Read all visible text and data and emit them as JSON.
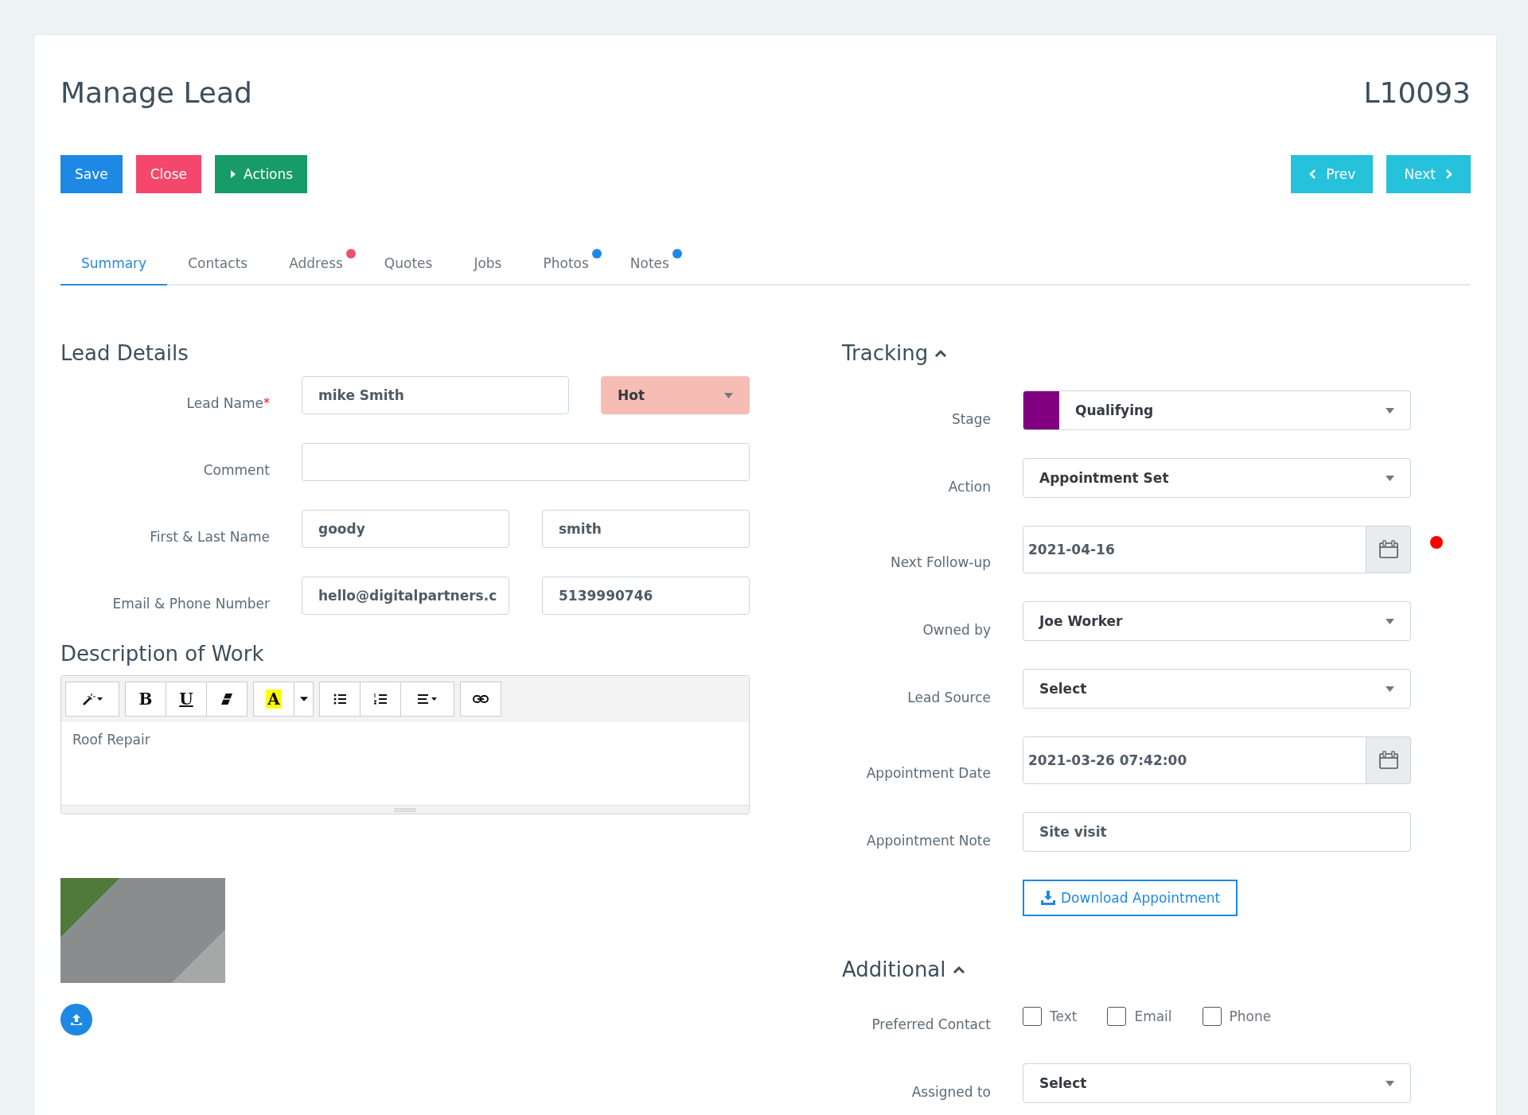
{
  "header": {
    "title": "Manage Lead",
    "record_id": "L10093"
  },
  "actions": [
    {
      "label": "Save",
      "kind": "save"
    },
    {
      "label": "Close",
      "kind": "close"
    },
    {
      "label": "Actions",
      "kind": "actions"
    }
  ],
  "pager": [
    {
      "label": "Prev",
      "kind": "prev"
    },
    {
      "label": "Next",
      "kind": "next"
    }
  ],
  "tabs": [
    {
      "label": "Summary",
      "selected": true
    },
    {
      "label": "Contacts",
      "selected": false
    },
    {
      "label": "Address",
      "selected": false,
      "color": "#f0506e"
    },
    {
      "label": "Quotes",
      "selected": false
    },
    {
      "label": "Jobs",
      "selected": false
    },
    {
      "label": "Photos",
      "selected": false,
      "color": "#1e88e5"
    },
    {
      "label": "Notes",
      "selected": false,
      "color": "#1e88e5"
    }
  ],
  "lead_details": {
    "heading": "Lead Details",
    "rows": [
      {
        "kind": "name_priority",
        "label": "Lead Name",
        "required_mark": "*",
        "value": "mike Smith",
        "priority": {
          "value": "Hot",
          "color": "#f6bdb5"
        }
      },
      {
        "kind": "text",
        "label": "Comment"
      },
      {
        "kind": "pair",
        "label": "First & Last Name",
        "values": [
          "goody",
          "smith"
        ]
      },
      {
        "kind": "pair",
        "label": "Email & Phone Number",
        "values": [
          "hello@digitalpartners.c",
          "5139990746"
        ]
      }
    ]
  },
  "description": {
    "heading": "Description of Work",
    "content": "Roof Repair",
    "toolbar": [
      {
        "kind": "style"
      },
      {
        "kind": "bold",
        "label": "B"
      },
      {
        "kind": "underline",
        "label": "U"
      },
      {
        "kind": "eraser"
      },
      {
        "kind": "highlight",
        "label": "A"
      },
      {
        "kind": "dropdown"
      },
      {
        "kind": "bullets"
      },
      {
        "kind": "numbers"
      },
      {
        "kind": "align"
      },
      {
        "kind": "link"
      }
    ]
  },
  "tracking": {
    "heading": "Tracking",
    "expanded": true,
    "rows": [
      {
        "kind": "stage",
        "label": "Stage",
        "value": "Qualifying",
        "color": "#800080"
      },
      {
        "kind": "select",
        "label": "Action",
        "value": "Appointment Set"
      },
      {
        "kind": "date",
        "label": "Next Follow-up",
        "value": "2021-04-16",
        "alert": true
      },
      {
        "kind": "select",
        "label": "Owned by",
        "value": "Joe Worker"
      },
      {
        "kind": "select",
        "label": "Lead Source",
        "value": "Select"
      },
      {
        "kind": "date",
        "label": "Appointment Date",
        "value": "2021-03-26 07:42:00"
      },
      {
        "kind": "text",
        "label": "Appointment Note",
        "value": "Site visit"
      },
      {
        "kind": "button",
        "label": "Download Appointment"
      }
    ]
  },
  "additional": {
    "heading": "Additional",
    "expanded": true,
    "rows": [
      {
        "kind": "checkboxes",
        "label": "Preferred Contact",
        "options": [
          {
            "label": "Text",
            "checked": false
          },
          {
            "label": "Email",
            "checked": false
          },
          {
            "label": "Phone",
            "checked": false
          }
        ]
      },
      {
        "kind": "select",
        "label": "Assigned to",
        "value": "Select"
      }
    ]
  }
}
